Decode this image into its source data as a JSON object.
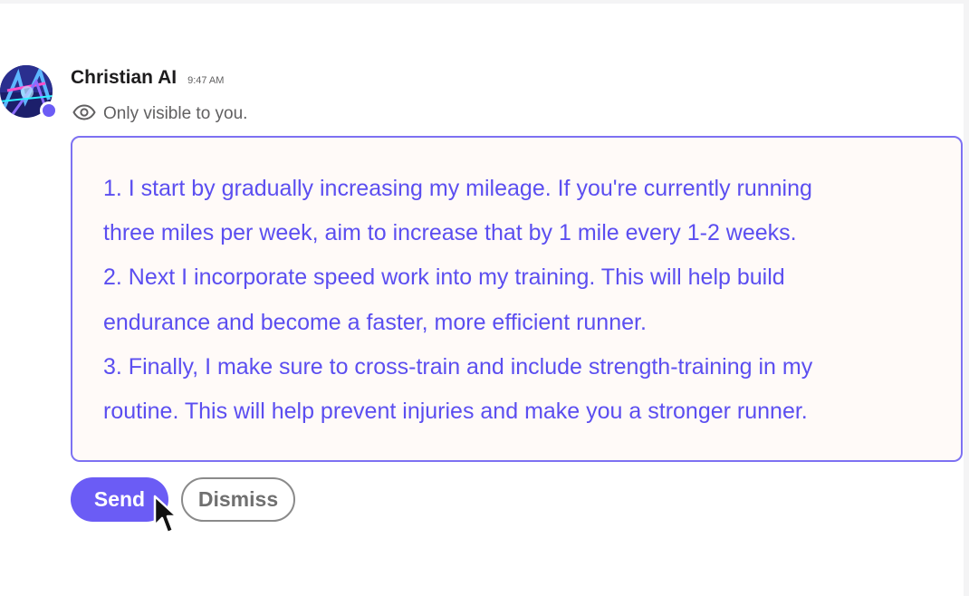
{
  "message": {
    "sender_name": "Christian AI",
    "timestamp": "9:47 AM",
    "visibility_note": "Only visible to you.",
    "avatar_icon": "abstract-avatar-image",
    "presence_color": "#6b5cf5",
    "body_lines": [
      "1. I start by gradually increasing my mileage. If you're currently running",
      "three miles per week, aim to increase that by 1 mile every 1-2 weeks.",
      "2. Next I incorporate speed work into my training. This will help build",
      "endurance and become a faster, more efficient runner.",
      "3. Finally, I make sure to cross-train and include strength-training in my",
      "routine. This will help prevent injuries and make you a stronger runner."
    ]
  },
  "actions": {
    "send_label": "Send",
    "dismiss_label": "Dismiss"
  },
  "icons": {
    "visibility": "eye-icon",
    "pointer": "mouse-cursor-icon"
  },
  "colors": {
    "accent": "#6b5cf5",
    "message_text": "#5b4ef0",
    "message_border": "#7d71f2",
    "message_background": "#fffaf8"
  }
}
